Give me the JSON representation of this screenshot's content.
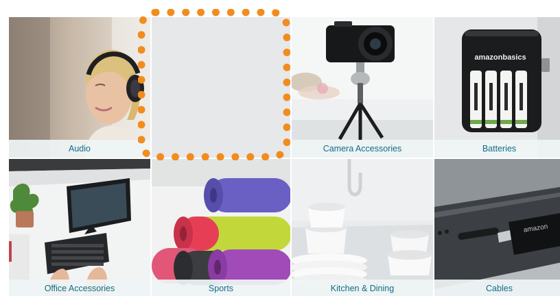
{
  "tiles": [
    {
      "label": "Audio",
      "icon": "headphones-photo"
    },
    {
      "label": "",
      "icon": "loading-placeholder"
    },
    {
      "label": "Camera Accessories",
      "icon": "camera-tripod-photo"
    },
    {
      "label": "Batteries",
      "icon": "battery-charger-photo"
    },
    {
      "label": "Office Accessories",
      "icon": "keyboard-tablet-photo"
    },
    {
      "label": "Sports",
      "icon": "yoga-mats-photo"
    },
    {
      "label": "Kitchen & Dining",
      "icon": "dishes-photo"
    },
    {
      "label": "Cables",
      "icon": "lightning-cable-photo"
    }
  ],
  "brand_text": "amazonbasics",
  "colors": {
    "caption_text": "#0f6e85",
    "focus_outline": "#f28c1f",
    "placeholder_bg": "#e6e8ea"
  },
  "focus": {
    "tile_index": 1,
    "style": "dotted-orange-outline"
  }
}
